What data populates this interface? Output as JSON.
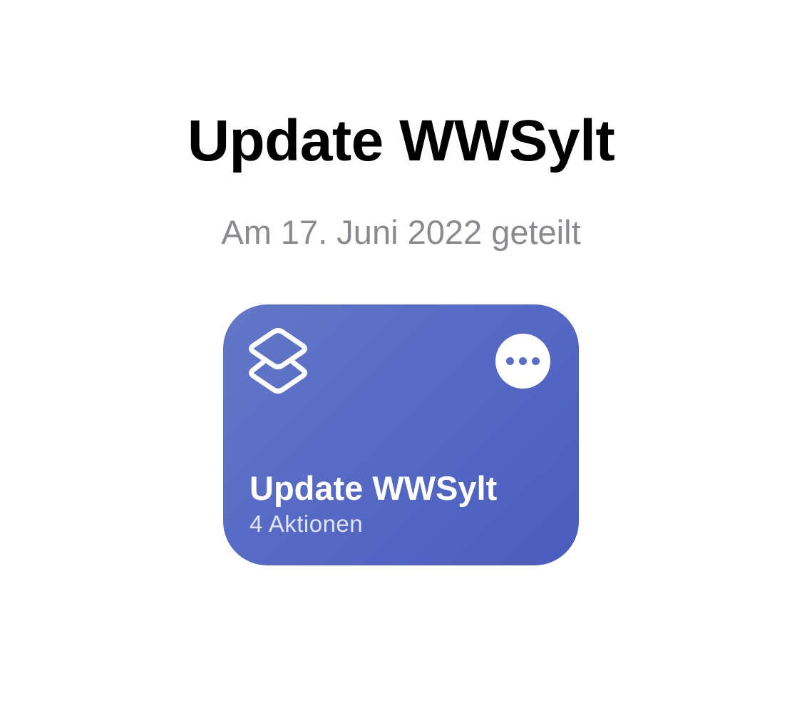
{
  "header": {
    "title": "Update WWSylt",
    "shared_date": "Am 17. Juni 2022 geteilt"
  },
  "shortcut_card": {
    "title": "Update WWSylt",
    "subtitle": "4 Aktionen",
    "icon": "shortcuts-layers-icon",
    "more_icon": "ellipsis-icon",
    "colors": {
      "gradient_start": "#6377c8",
      "gradient_end": "#4a5cbd",
      "text": "#ffffff"
    }
  }
}
